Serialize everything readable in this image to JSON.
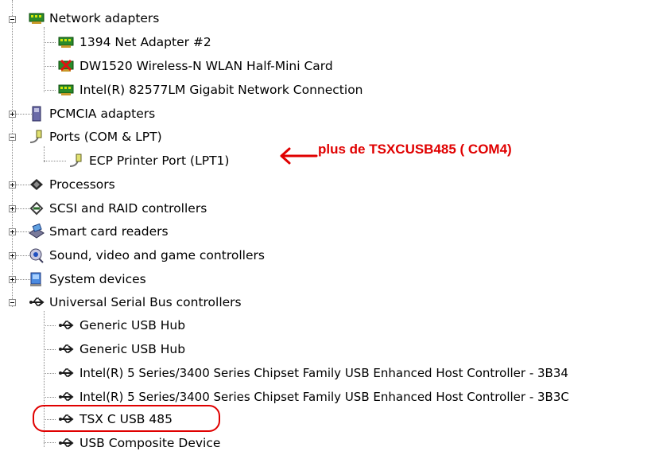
{
  "tree": {
    "items": [
      {
        "label": "Network adapters",
        "level": 0,
        "state": "expanded",
        "icon": "network-adapter-icon"
      },
      {
        "label": "1394 Net Adapter #2",
        "level": 1,
        "icon": "network-adapter-icon"
      },
      {
        "label": "DW1520 Wireless-N WLAN Half-Mini Card",
        "level": 1,
        "icon": "network-adapter-disabled-icon"
      },
      {
        "label": "Intel(R) 82577LM Gigabit Network Connection",
        "level": 1,
        "icon": "network-adapter-icon"
      },
      {
        "label": "PCMCIA adapters",
        "level": 0,
        "state": "collapsed",
        "icon": "pcmcia-icon"
      },
      {
        "label": "Ports (COM & LPT)",
        "level": 0,
        "state": "expanded",
        "icon": "port-icon"
      },
      {
        "label": "ECP Printer Port (LPT1)",
        "level": 1,
        "icon": "port-icon"
      },
      {
        "label": "Processors",
        "level": 0,
        "state": "collapsed",
        "icon": "processor-icon"
      },
      {
        "label": "SCSI and RAID controllers",
        "level": 0,
        "state": "collapsed",
        "icon": "scsi-icon"
      },
      {
        "label": "Smart card readers",
        "level": 0,
        "state": "collapsed",
        "icon": "smart-card-reader-icon"
      },
      {
        "label": "Sound, video and game controllers",
        "level": 0,
        "state": "collapsed",
        "icon": "sound-icon"
      },
      {
        "label": "System devices",
        "level": 0,
        "state": "collapsed",
        "icon": "system-devices-icon"
      },
      {
        "label": "Universal Serial Bus controllers",
        "level": 0,
        "state": "expanded",
        "icon": "usb-icon"
      },
      {
        "label": "Generic USB Hub",
        "level": 1,
        "icon": "usb-icon"
      },
      {
        "label": "Generic USB Hub",
        "level": 1,
        "icon": "usb-icon"
      },
      {
        "label": "Intel(R) 5 Series/3400 Series Chipset Family USB Enhanced Host Controller - 3B34",
        "level": 1,
        "icon": "usb-icon"
      },
      {
        "label": "Intel(R) 5 Series/3400 Series Chipset Family USB Enhanced Host Controller - 3B3C",
        "level": 1,
        "icon": "usb-icon"
      },
      {
        "label": "TSX C USB 485",
        "level": 1,
        "icon": "usb-icon"
      },
      {
        "label": "USB Composite Device",
        "level": 1,
        "icon": "usb-icon"
      }
    ]
  },
  "annotation": {
    "arrow_text": "plus de TSXCUSB485 ( COM4)",
    "color": "#e00000"
  }
}
